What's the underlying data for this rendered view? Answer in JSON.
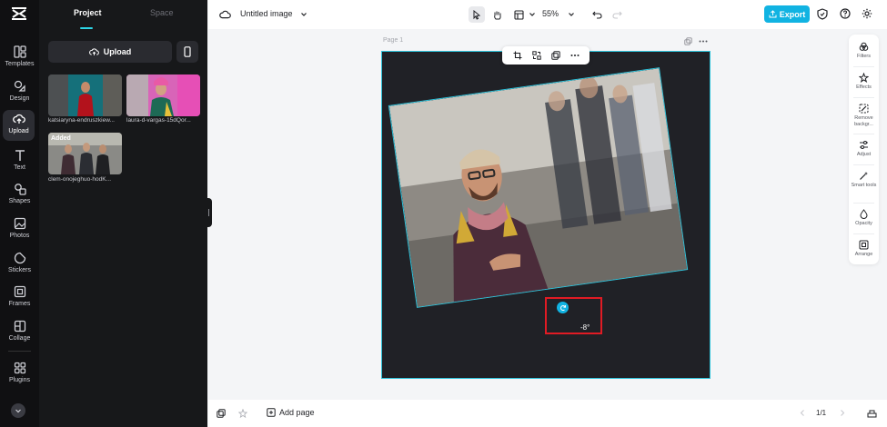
{
  "rail": {
    "items": [
      {
        "label": "Templates",
        "icon": "templates-icon"
      },
      {
        "label": "Design",
        "icon": "design-icon"
      },
      {
        "label": "Upload",
        "icon": "upload-icon",
        "active": true
      },
      {
        "label": "Text",
        "icon": "text-icon"
      },
      {
        "label": "Shapes",
        "icon": "shapes-icon"
      },
      {
        "label": "Photos",
        "icon": "photos-icon"
      },
      {
        "label": "Stickers",
        "icon": "stickers-icon"
      },
      {
        "label": "Frames",
        "icon": "frames-icon"
      },
      {
        "label": "Collage",
        "icon": "collage-icon"
      },
      {
        "label": "Plugins",
        "icon": "plugins-icon"
      }
    ]
  },
  "panel": {
    "tabs": [
      {
        "label": "Project",
        "active": true
      },
      {
        "label": "Space",
        "active": false
      }
    ],
    "upload_label": "Upload",
    "uploads": [
      {
        "name": "katsiaryna-endruszkiew...",
        "added": false
      },
      {
        "name": "laura-d-vargas-15dQor...",
        "added": false
      },
      {
        "name": "clem-onojeghuo-hodK...",
        "added": true,
        "tag": "Added"
      }
    ]
  },
  "topbar": {
    "title": "Untitled image",
    "zoom": "55%",
    "export_label": "Export"
  },
  "canvas": {
    "page_label": "Page 1",
    "rotation_readout": "-8°"
  },
  "right_tools": [
    {
      "label": "Filters",
      "icon": "filters-icon"
    },
    {
      "label": "Effects",
      "icon": "effects-icon"
    },
    {
      "label": "Remove backgr...",
      "icon": "remove-background-icon"
    },
    {
      "label": "Adjust",
      "icon": "adjust-icon"
    },
    {
      "label": "Smart tools",
      "icon": "smart-tools-icon"
    },
    {
      "label": "Opacity",
      "icon": "opacity-icon"
    },
    {
      "label": "Arrange",
      "icon": "arrange-icon"
    }
  ],
  "bottombar": {
    "add_page_label": "Add page",
    "page_count": "1/1"
  },
  "colors": {
    "accent": "#11b3e2",
    "selection": "#2ec4dc",
    "highlight_box": "#e01b24",
    "rail_bg": "#101012",
    "panel_bg": "#17181a",
    "artboard_bg": "#202126"
  }
}
